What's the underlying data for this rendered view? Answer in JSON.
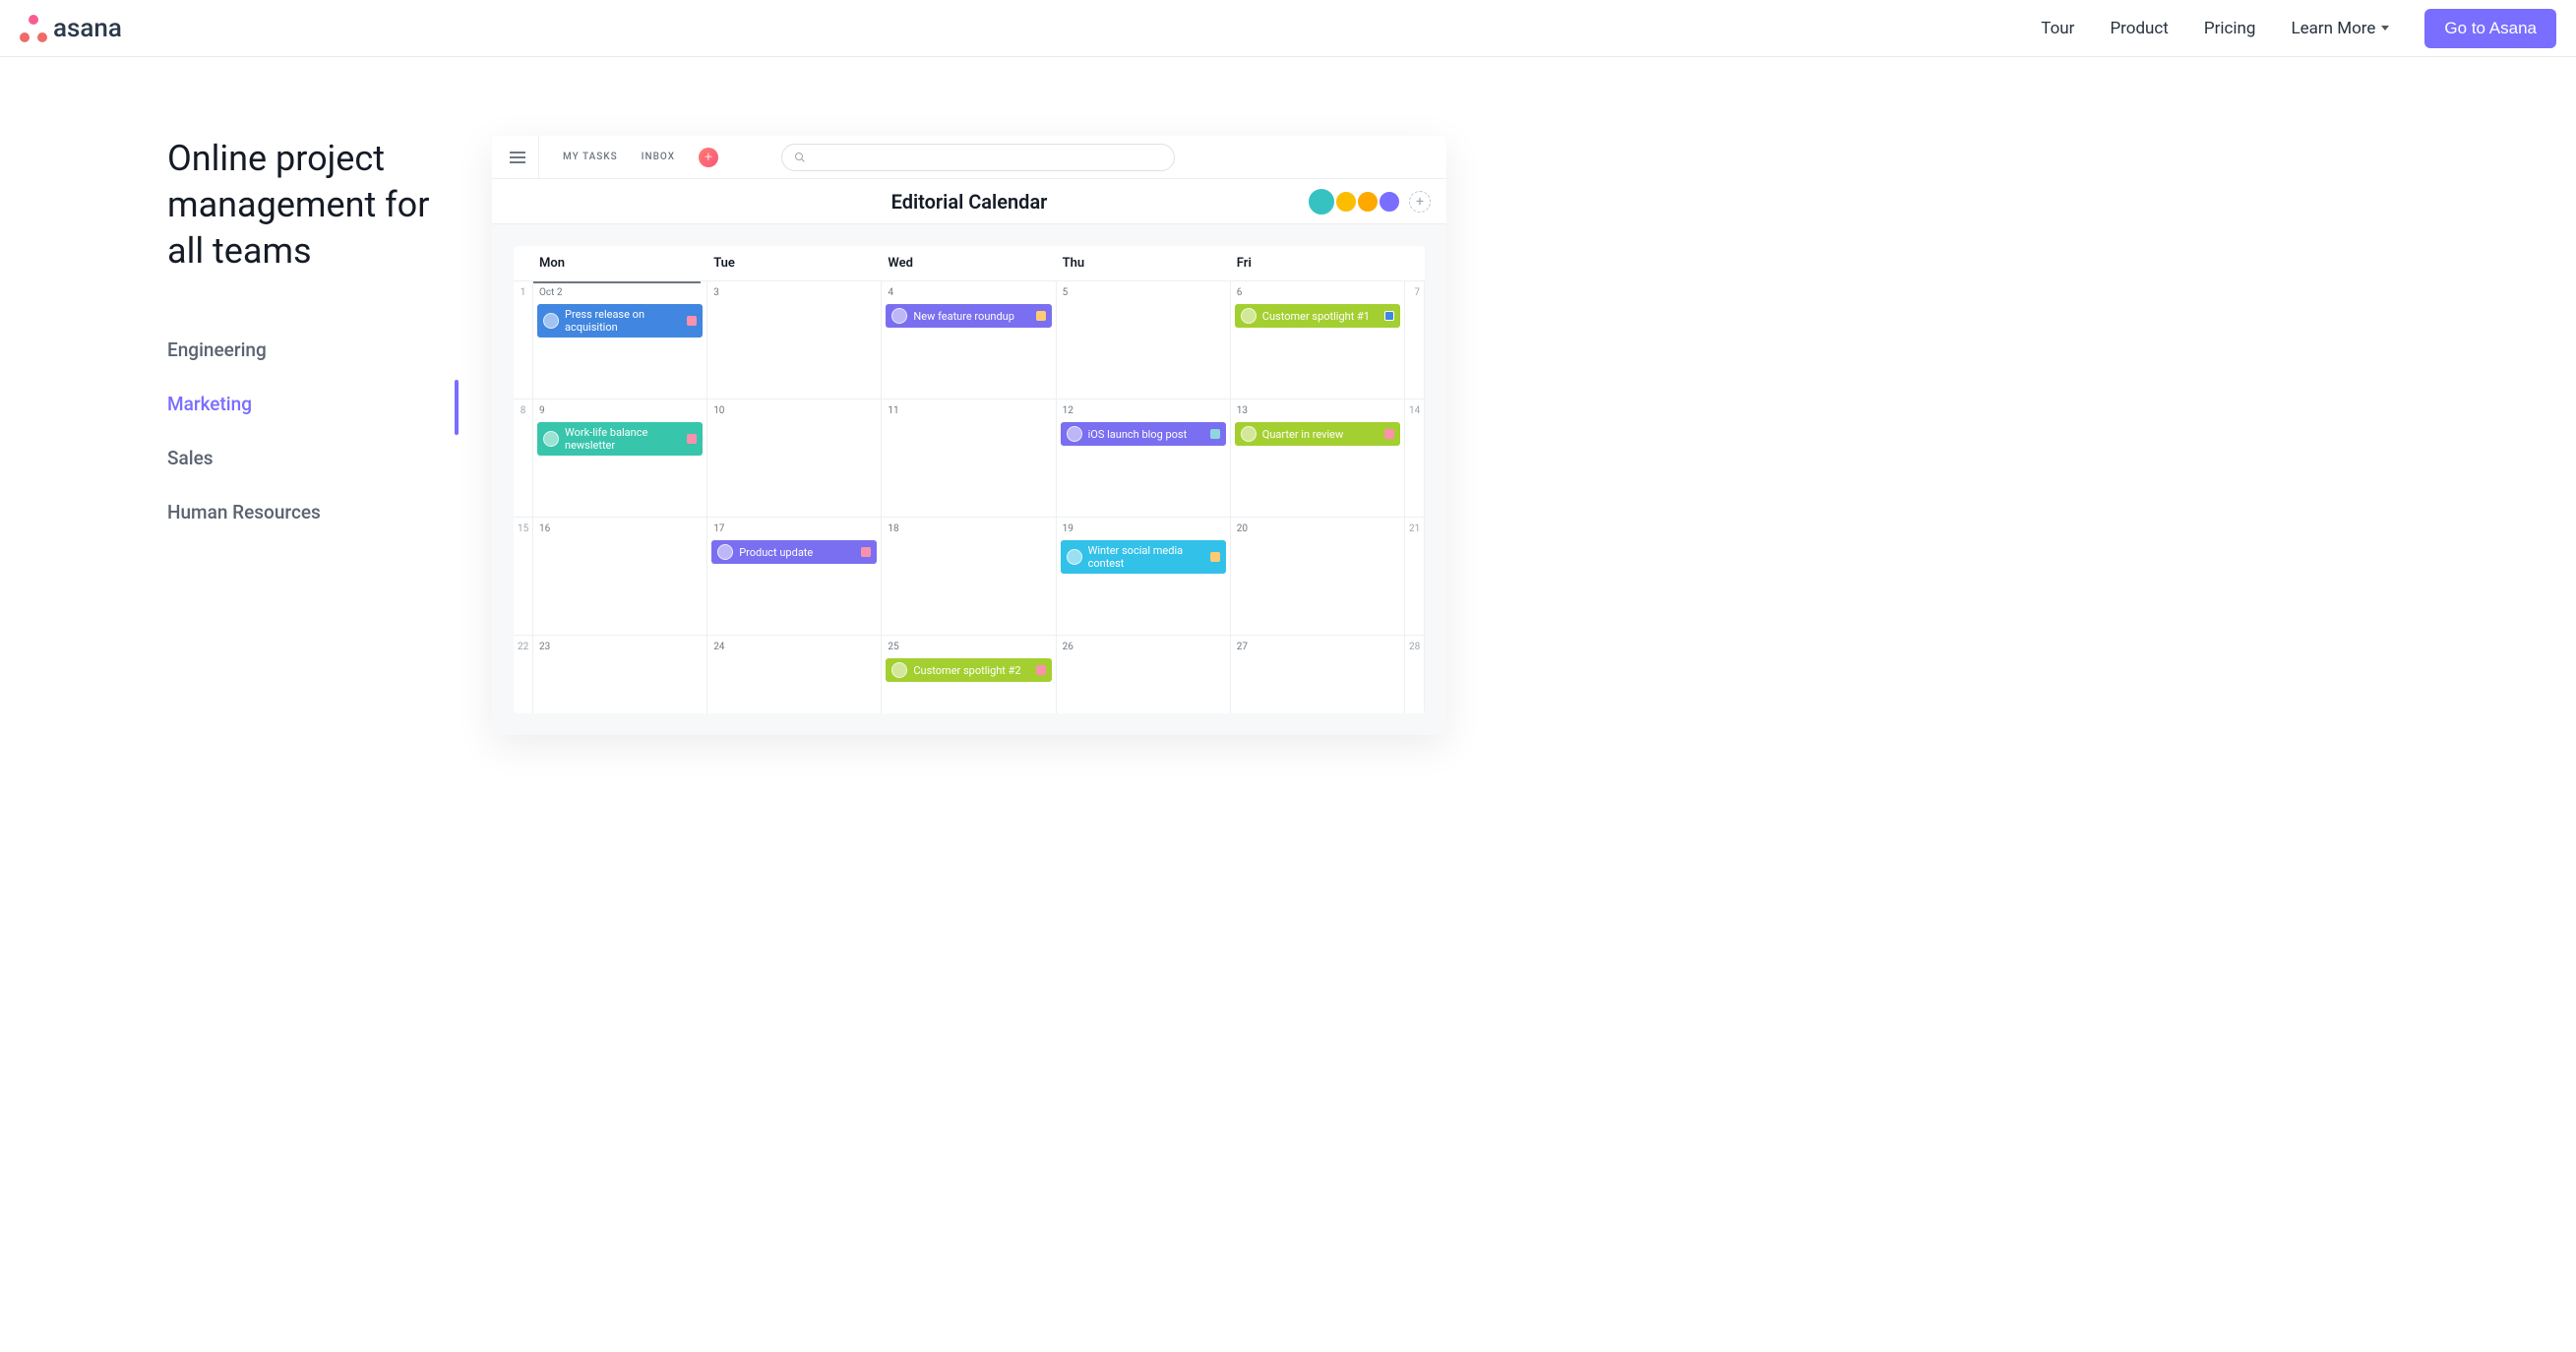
{
  "nav": {
    "brand": "asana",
    "links": [
      "Tour",
      "Product",
      "Pricing",
      "Learn More"
    ],
    "cta": "Go to Asana"
  },
  "hero": {
    "headline": "Online project management for all teams",
    "teams": [
      "Engineering",
      "Marketing",
      "Sales",
      "Human Resources"
    ],
    "active_team_index": 1
  },
  "app": {
    "toolbar": {
      "my_tasks": "MY TASKS",
      "inbox": "INBOX"
    },
    "title": "Editorial Calendar",
    "calendar": {
      "days": [
        "Mon",
        "Tue",
        "Wed",
        "Thu",
        "Fri"
      ],
      "rows": [
        {
          "left": "1",
          "right": "7",
          "cells": [
            "Oct 2",
            "3",
            "4",
            "5",
            "6"
          ]
        },
        {
          "left": "8",
          "right": "14",
          "cells": [
            "9",
            "10",
            "11",
            "12",
            "13"
          ]
        },
        {
          "left": "15",
          "right": "21",
          "cells": [
            "16",
            "17",
            "18",
            "19",
            "20"
          ]
        },
        {
          "left": "22",
          "right": "28",
          "cells": [
            "23",
            "24",
            "25",
            "26",
            "27"
          ]
        }
      ],
      "tasks": {
        "press_release": "Press release on acquisition",
        "feature_roundup": "New feature roundup",
        "spotlight1": "Customer spotlight #1",
        "worklife": "Work-life balance newsletter",
        "ios_launch": "iOS launch blog post",
        "quarter_review": "Quarter in review",
        "product_update": "Product update",
        "winter_contest": "Winter social media contest",
        "spotlight2": "Customer spotlight #2"
      }
    }
  }
}
